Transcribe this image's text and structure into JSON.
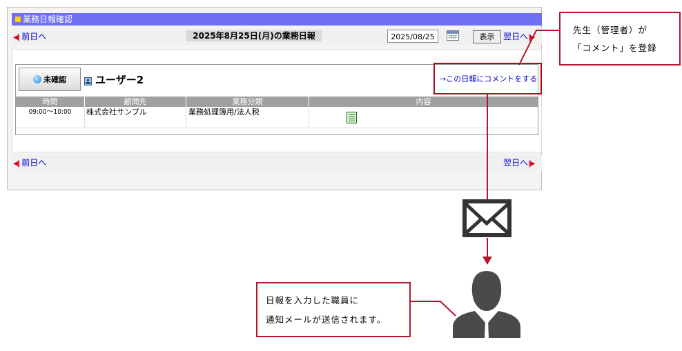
{
  "window": {
    "title": "業務日報確認"
  },
  "nav": {
    "prev_label": "前日へ",
    "next_label": "翌日へ",
    "prev_arrow": "◀||",
    "next_arrow": "||▶"
  },
  "report": {
    "title": "2025年8月25日(月)の業務日報",
    "date_value": "2025/08/25",
    "show_button": "表示"
  },
  "entry": {
    "status_label": "未確認",
    "user_name": "ユーザー2",
    "comment_link": "→この日報にコメントをする",
    "columns": [
      "時間",
      "顧問先",
      "業務分類",
      "内容"
    ],
    "rows": [
      {
        "time": "09:00〜10:00",
        "client": "株式会社サンプル",
        "category": "業務処理簿用/法人税",
        "content_icon": "document-icon"
      }
    ]
  },
  "annotations": {
    "teacher_note": [
      "先生（管理者）が",
      "「コメント」を登録"
    ],
    "staff_note": [
      "日報を入力した職員に",
      "通知メールが送信されます。"
    ]
  },
  "icons": {
    "mail": "envelope-icon",
    "person": "person-silhouette-icon",
    "calendar": "calendar-icon"
  },
  "colors": {
    "title_bar": "#6f6ff2",
    "annotation_red": "#b3152a",
    "link_blue": "#0000cc",
    "silhouette": "#4a4a4a"
  }
}
